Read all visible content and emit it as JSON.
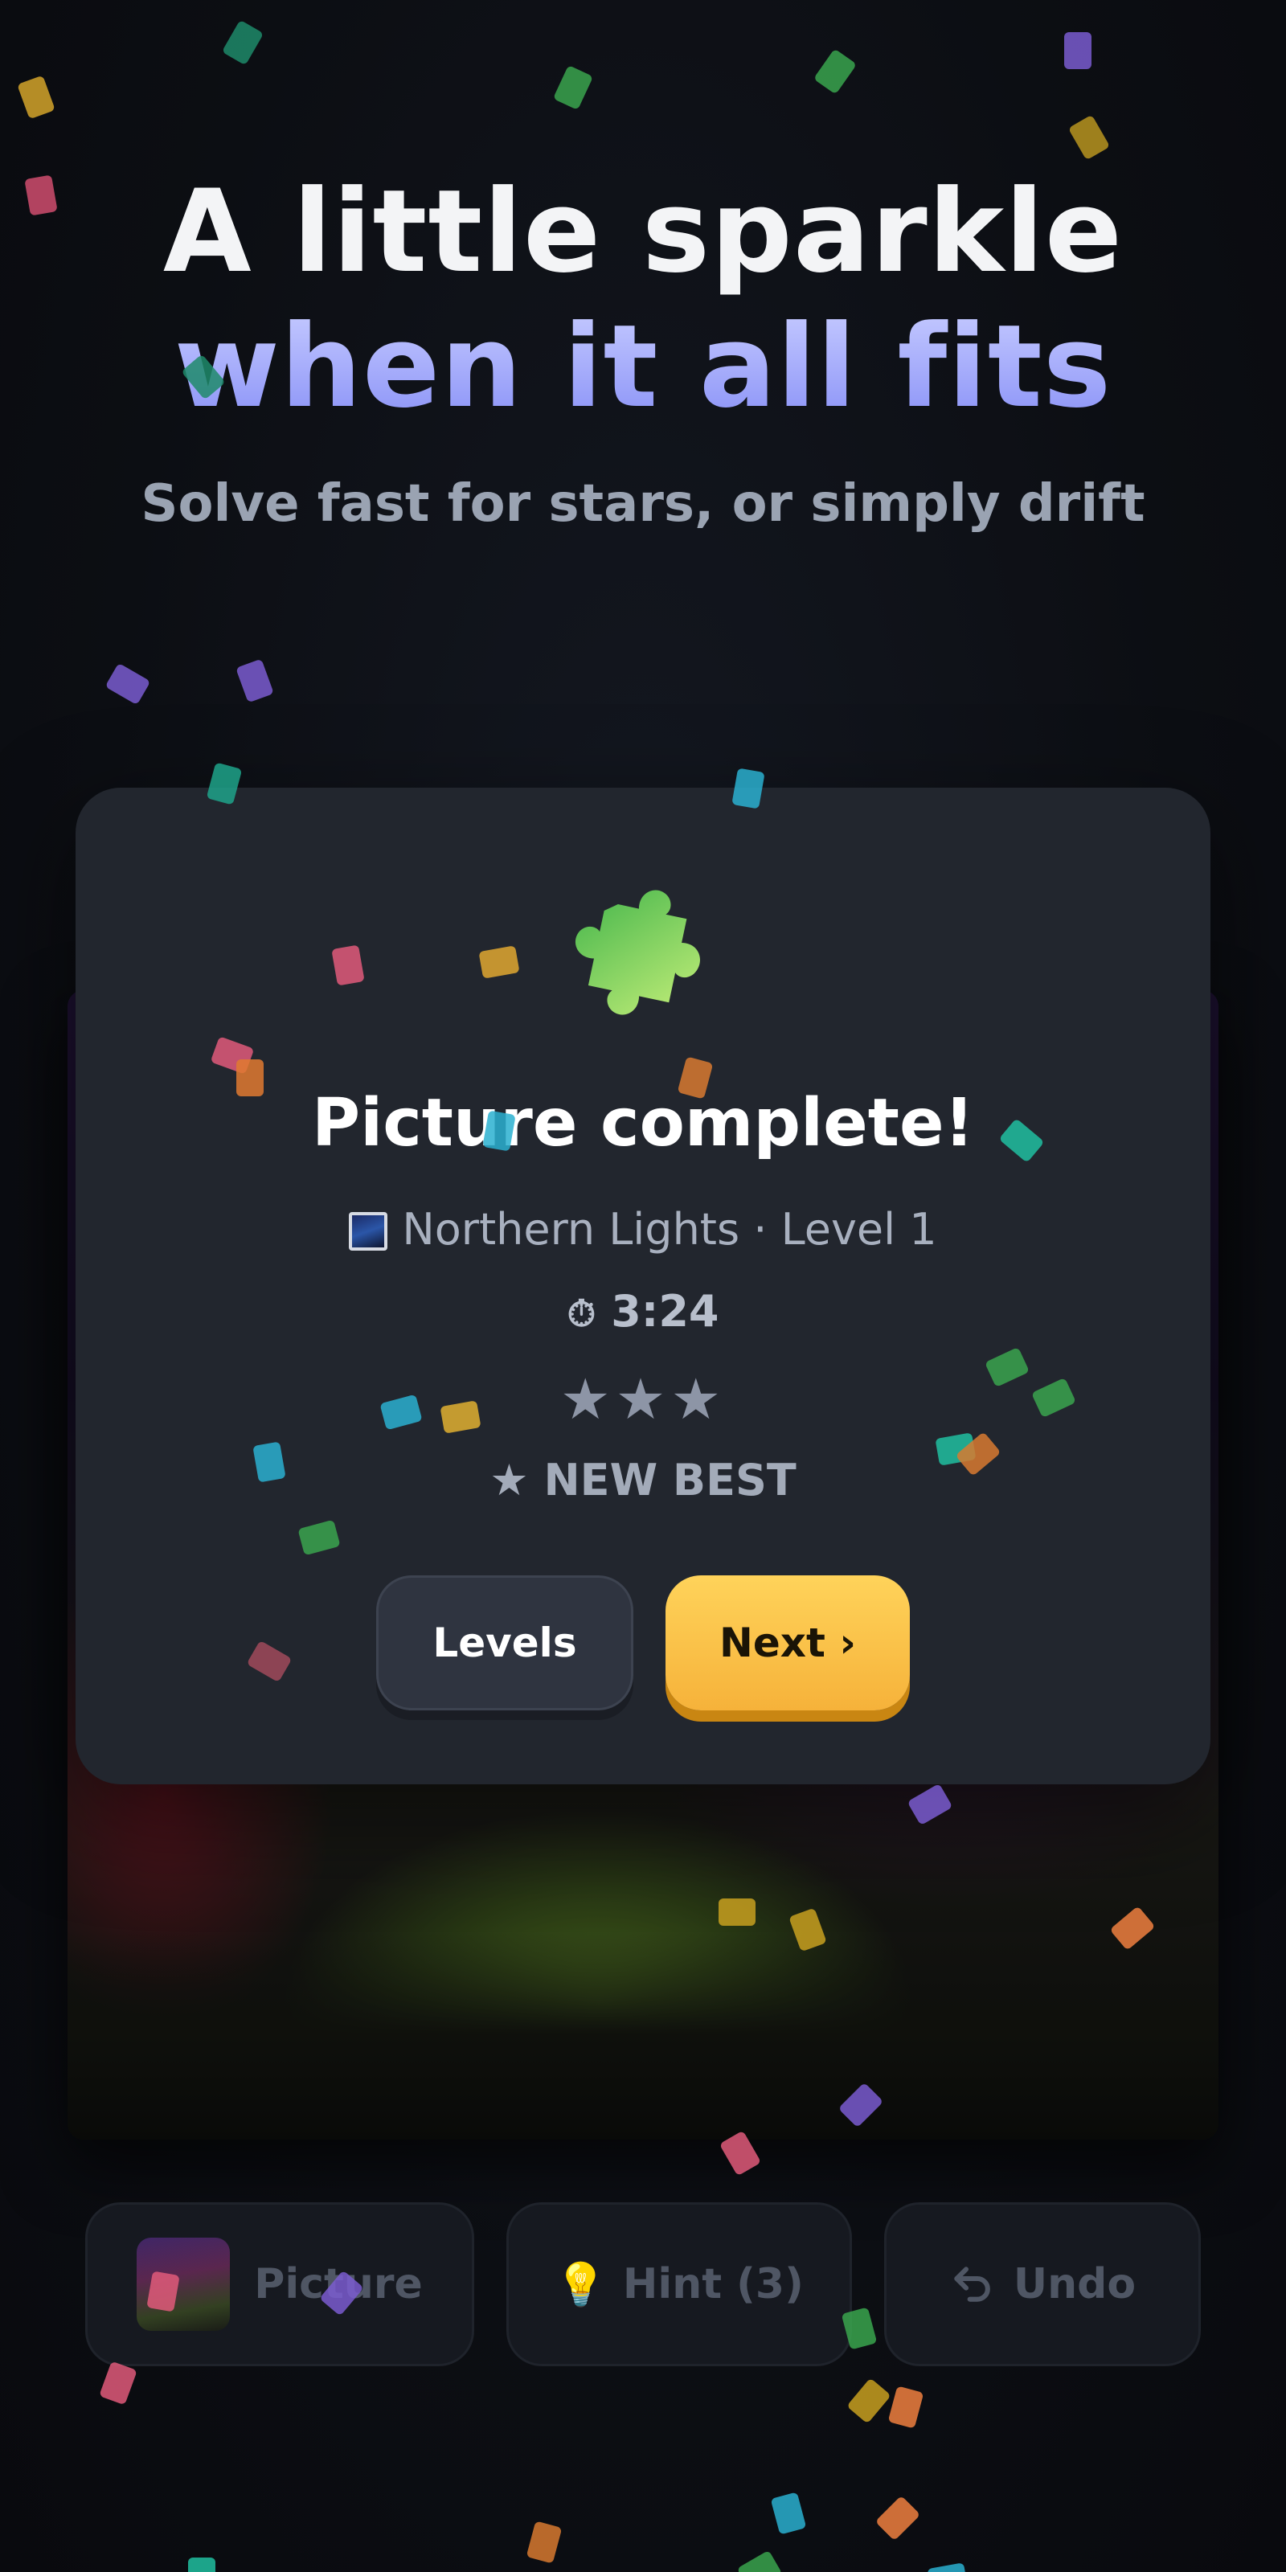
{
  "header": {
    "title_line1": "A little sparkle",
    "title_line2": "when it all fits",
    "subtitle": "Solve fast for stars, or simply drift"
  },
  "modal": {
    "title": "Picture complete!",
    "level": "Northern Lights · Level 1",
    "time": "3:24",
    "stars": "★★★",
    "stars_earned": 3,
    "new_best": "★ NEW BEST",
    "levels_button": "Levels",
    "next_button": "Next ›"
  },
  "toolbar": {
    "picture_label": "Picture",
    "hint_label": "Hint (3)",
    "undo_label": "Undo"
  },
  "icons": {
    "puzzle": "puzzle-icon",
    "level_thumb": "landscape-icon",
    "timer": "stopwatch-icon",
    "hint": "lightbulb-icon",
    "undo": "undo-arrow-icon"
  },
  "colors": {
    "accent_gradient_top": "#c3c8ff",
    "accent_gradient_bottom": "#8b93f7",
    "next_button": "#f6b23a",
    "modal_background": "#22262e",
    "puzzle_green": "#7ed35a"
  }
}
